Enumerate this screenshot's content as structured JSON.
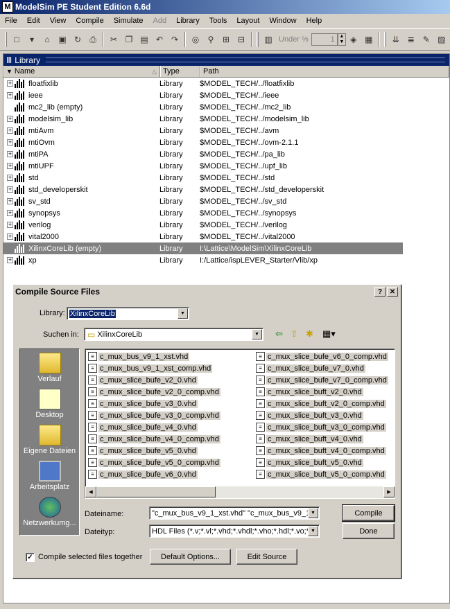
{
  "app": {
    "title": "ModelSim PE Student Edition 6.6d",
    "icon_letter": "M"
  },
  "menu": [
    "File",
    "Edit",
    "View",
    "Compile",
    "Simulate",
    "Add",
    "Library",
    "Tools",
    "Layout",
    "Window",
    "Help"
  ],
  "toolbar": {
    "under_label": "Under %",
    "under_value": "1"
  },
  "library_pane": {
    "title": "Library",
    "columns": {
      "name": "Name",
      "type": "Type",
      "path": "Path"
    },
    "rows": [
      {
        "name": "floatfixlib",
        "type": "Library",
        "path": "$MODEL_TECH/../floatfixlib",
        "expandable": true
      },
      {
        "name": "ieee",
        "type": "Library",
        "path": "$MODEL_TECH/../ieee",
        "expandable": true
      },
      {
        "name": "mc2_lib  (empty)",
        "type": "Library",
        "path": "$MODEL_TECH/../mc2_lib",
        "expandable": false
      },
      {
        "name": "modelsim_lib",
        "type": "Library",
        "path": "$MODEL_TECH/../modelsim_lib",
        "expandable": true
      },
      {
        "name": "mtiAvm",
        "type": "Library",
        "path": "$MODEL_TECH/../avm",
        "expandable": true
      },
      {
        "name": "mtiOvm",
        "type": "Library",
        "path": "$MODEL_TECH/../ovm-2.1.1",
        "expandable": true
      },
      {
        "name": "mtiPA",
        "type": "Library",
        "path": "$MODEL_TECH/../pa_lib",
        "expandable": true
      },
      {
        "name": "mtiUPF",
        "type": "Library",
        "path": "$MODEL_TECH/../upf_lib",
        "expandable": true
      },
      {
        "name": "std",
        "type": "Library",
        "path": "$MODEL_TECH/../std",
        "expandable": true
      },
      {
        "name": "std_developerskit",
        "type": "Library",
        "path": "$MODEL_TECH/../std_developerskit",
        "expandable": true
      },
      {
        "name": "sv_std",
        "type": "Library",
        "path": "$MODEL_TECH/../sv_std",
        "expandable": true
      },
      {
        "name": "synopsys",
        "type": "Library",
        "path": "$MODEL_TECH/../synopsys",
        "expandable": true
      },
      {
        "name": "verilog",
        "type": "Library",
        "path": "$MODEL_TECH/../verilog",
        "expandable": true
      },
      {
        "name": "vital2000",
        "type": "Library",
        "path": "$MODEL_TECH/../vital2000",
        "expandable": true
      },
      {
        "name": "XilinxCoreLib  (empty)",
        "type": "Library",
        "path": "I:\\Lattice\\ModelSim\\XilinxCoreLib",
        "expandable": false,
        "selected": true
      },
      {
        "name": "xp",
        "type": "Library",
        "path": "I:/Lattice/ispLEVER_Starter/Vlib/xp",
        "expandable": true
      }
    ]
  },
  "dialog": {
    "title": "Compile Source Files",
    "help_button": "?",
    "close_button": "✕",
    "library_label": "Library:",
    "library_value": "XilinxCoreLib",
    "look_in_label": "Suchen in:",
    "look_in_value": "XilinxCoreLib",
    "places": [
      "Verlauf",
      "Desktop",
      "Eigene Dateien",
      "Arbeitsplatz",
      "Netzwerkumg..."
    ],
    "files_col1": [
      "c_mux_bus_v9_1_xst.vhd",
      "c_mux_bus_v9_1_xst_comp.vhd",
      "c_mux_slice_bufe_v2_0.vhd",
      "c_mux_slice_bufe_v2_0_comp.vhd",
      "c_mux_slice_bufe_v3_0.vhd",
      "c_mux_slice_bufe_v3_0_comp.vhd",
      "c_mux_slice_bufe_v4_0.vhd",
      "c_mux_slice_bufe_v4_0_comp.vhd",
      "c_mux_slice_bufe_v5_0.vhd",
      "c_mux_slice_bufe_v5_0_comp.vhd",
      "c_mux_slice_bufe_v6_0.vhd"
    ],
    "files_col2": [
      "c_mux_slice_bufe_v6_0_comp.vhd",
      "c_mux_slice_bufe_v7_0.vhd",
      "c_mux_slice_bufe_v7_0_comp.vhd",
      "c_mux_slice_buft_v2_0.vhd",
      "c_mux_slice_buft_v2_0_comp.vhd",
      "c_mux_slice_buft_v3_0.vhd",
      "c_mux_slice_buft_v3_0_comp.vhd",
      "c_mux_slice_buft_v4_0.vhd",
      "c_mux_slice_buft_v4_0_comp.vhd",
      "c_mux_slice_buft_v5_0.vhd",
      "c_mux_slice_buft_v5_0_comp.vhd"
    ],
    "filename_label": "Dateiname:",
    "filename_value": "\"c_mux_bus_v9_1_xst.vhd\" \"c_mux_bus_v9_1",
    "filetype_label": "Dateityp:",
    "filetype_value": "HDL Files (*.v;*.vl;*.vhd;*.vhdl;*.vho;*.hdl;*.vo;*",
    "compile_button": "Compile",
    "done_button": "Done",
    "compile_together_label": "Compile selected files together",
    "compile_together_checked": true,
    "default_options_button": "Default Options...",
    "edit_source_button": "Edit Source"
  }
}
